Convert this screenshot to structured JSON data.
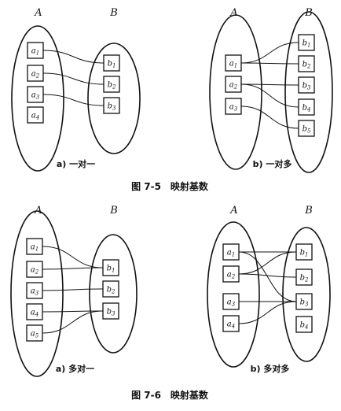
{
  "set_a_label": "A",
  "set_b_label": "B",
  "figures": [
    {
      "caption": "图 7-5　映射基数",
      "panels": [
        {
          "id": "a",
          "caption": "a) 一对一",
          "left": [
            [
              "a",
              "1"
            ],
            [
              "a",
              "2"
            ],
            [
              "a",
              "3"
            ],
            [
              "a",
              "4"
            ]
          ],
          "right": [
            [
              "b",
              "1"
            ],
            [
              "b",
              "2"
            ],
            [
              "b",
              "3"
            ]
          ],
          "links": [
            [
              0,
              0
            ],
            [
              1,
              1
            ],
            [
              2,
              2
            ]
          ]
        },
        {
          "id": "b",
          "caption": "b) 一对多",
          "left": [
            [
              "a",
              "1"
            ],
            [
              "a",
              "2"
            ],
            [
              "a",
              "3"
            ]
          ],
          "right": [
            [
              "b",
              "1"
            ],
            [
              "b",
              "2"
            ],
            [
              "b",
              "3"
            ],
            [
              "b",
              "4"
            ],
            [
              "b",
              "5"
            ]
          ],
          "links": [
            [
              0,
              0
            ],
            [
              0,
              1
            ],
            [
              1,
              2
            ],
            [
              1,
              3
            ],
            [
              2,
              4
            ]
          ]
        }
      ]
    },
    {
      "caption": "图 7-6　映射基数",
      "panels": [
        {
          "id": "c",
          "caption": "a) 多对一",
          "left": [
            [
              "a",
              "1"
            ],
            [
              "a",
              "2"
            ],
            [
              "a",
              "3"
            ],
            [
              "a",
              "4"
            ],
            [
              "a",
              "5"
            ]
          ],
          "right": [
            [
              "b",
              "1"
            ],
            [
              "b",
              "2"
            ],
            [
              "b",
              "3"
            ]
          ],
          "links": [
            [
              0,
              0
            ],
            [
              1,
              0
            ],
            [
              2,
              1
            ],
            [
              3,
              2
            ],
            [
              4,
              2
            ]
          ]
        },
        {
          "id": "d",
          "caption": "b) 多对多",
          "left": [
            [
              "a",
              "1"
            ],
            [
              "a",
              "2"
            ],
            [
              "a",
              "3"
            ],
            [
              "a",
              "4"
            ]
          ],
          "right": [
            [
              "b",
              "1"
            ],
            [
              "b",
              "2"
            ],
            [
              "b",
              "3"
            ],
            [
              "b",
              "4"
            ]
          ],
          "links": [
            [
              0,
              0
            ],
            [
              0,
              2
            ],
            [
              1,
              0
            ],
            [
              1,
              1
            ],
            [
              2,
              2
            ],
            [
              3,
              2
            ]
          ]
        }
      ]
    }
  ]
}
